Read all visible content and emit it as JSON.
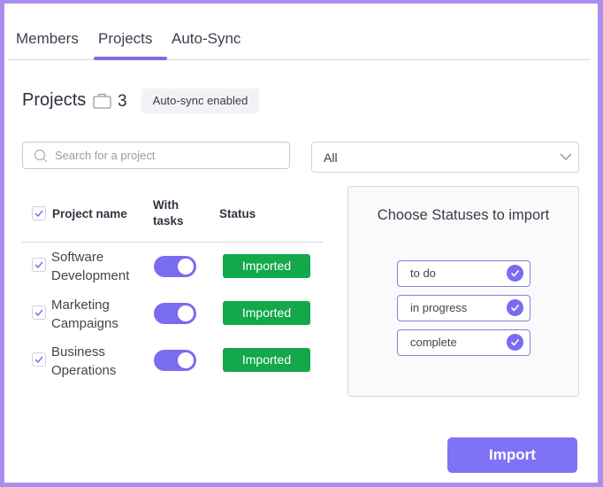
{
  "tabs": [
    {
      "label": "Members",
      "active": false
    },
    {
      "label": "Projects",
      "active": true
    },
    {
      "label": "Auto-Sync",
      "active": false
    }
  ],
  "header": {
    "title": "Projects",
    "count_icon": "briefcase-icon",
    "count": "3",
    "badge": "Auto-sync enabled"
  },
  "search": {
    "placeholder": "Search for a project",
    "value": "",
    "icon": "search-icon"
  },
  "filter": {
    "selected": "All",
    "icon": "chevron-down-icon"
  },
  "table": {
    "select_all_checked": true,
    "columns": [
      "Project name",
      "With tasks",
      "Status"
    ],
    "rows": [
      {
        "name_line1": "Software",
        "name_line2": "Development",
        "checked": true,
        "with_tasks": true,
        "status": "Imported"
      },
      {
        "name_line1": "Marketing",
        "name_line2": "Campaigns",
        "checked": true,
        "with_tasks": true,
        "status": "Imported"
      },
      {
        "name_line1": "Business",
        "name_line2": "Operations",
        "checked": true,
        "with_tasks": true,
        "status": "Imported"
      }
    ]
  },
  "status_panel": {
    "title": "Choose Statuses to import",
    "options": [
      {
        "label": "to do",
        "checked": true
      },
      {
        "label": "in progress",
        "checked": true
      },
      {
        "label": "complete",
        "checked": true
      }
    ]
  },
  "actions": {
    "import_label": "Import"
  },
  "colors": {
    "accent": "#7c6cf0",
    "status_imported": "#13a84a",
    "frame_border": "#a98ef0"
  }
}
